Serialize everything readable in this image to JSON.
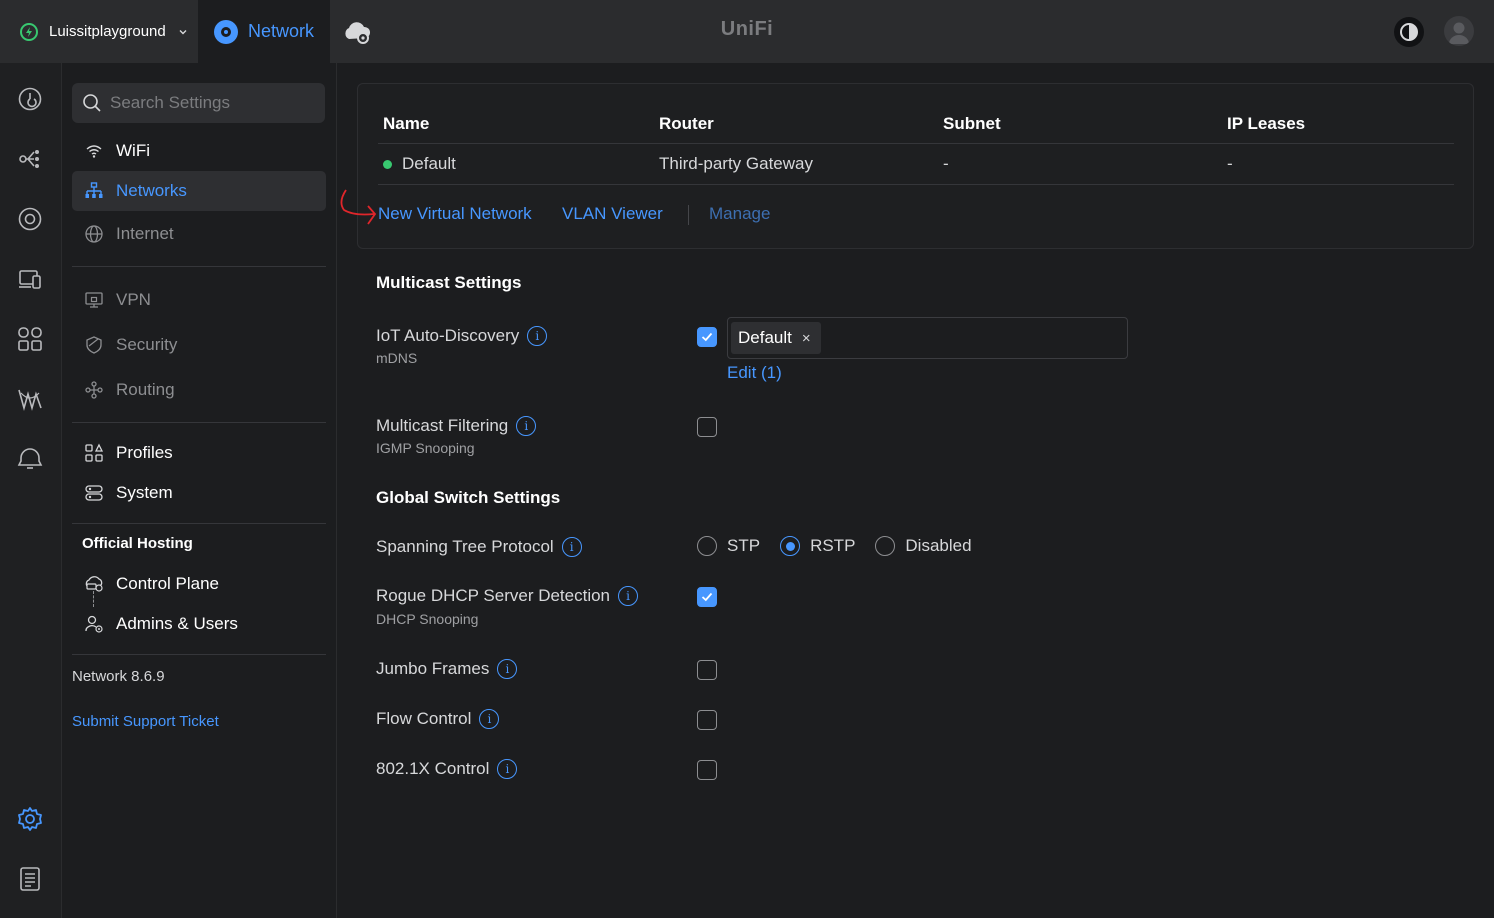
{
  "topbar": {
    "site_name": "Luissitplayground",
    "app_name": "Network",
    "brand": "UniFi"
  },
  "search": {
    "placeholder": "Search Settings"
  },
  "nav": {
    "wifi": "WiFi",
    "networks": "Networks",
    "internet": "Internet",
    "vpn": "VPN",
    "security": "Security",
    "routing": "Routing",
    "profiles": "Profiles",
    "system": "System",
    "hosting_heading": "Official Hosting",
    "control_plane": "Control Plane",
    "admins_users": "Admins & Users",
    "version": "Network 8.6.9",
    "support": "Submit Support Ticket"
  },
  "table": {
    "headers": [
      "Name",
      "Router",
      "Subnet",
      "IP Leases"
    ],
    "rows": [
      {
        "name": "Default",
        "router": "Third-party Gateway",
        "subnet": "-",
        "leases": "-"
      }
    ],
    "links": {
      "new_network": "New Virtual Network",
      "vlan_viewer": "VLAN Viewer",
      "manage": "Manage"
    }
  },
  "multicast": {
    "title": "Multicast Settings",
    "iot_label": "IoT Auto-Discovery",
    "iot_sub": "mDNS",
    "iot_chip": "Default",
    "iot_chip_remove": "×",
    "iot_edit": "Edit (1)",
    "filter_label": "Multicast Filtering",
    "filter_sub": "IGMP Snooping"
  },
  "switch": {
    "title": "Global Switch Settings",
    "stp_label": "Spanning Tree Protocol",
    "stp_options": [
      "STP",
      "RSTP",
      "Disabled"
    ],
    "rogue_label": "Rogue DHCP Server Detection",
    "rogue_sub": "DHCP Snooping",
    "jumbo_label": "Jumbo Frames",
    "flow_label": "Flow Control",
    "dot1x_label": "802.1X Control"
  },
  "info_glyph": "i",
  "colors": {
    "accent": "#4797ff",
    "online": "#38c870",
    "annotation": "#e0262b"
  }
}
